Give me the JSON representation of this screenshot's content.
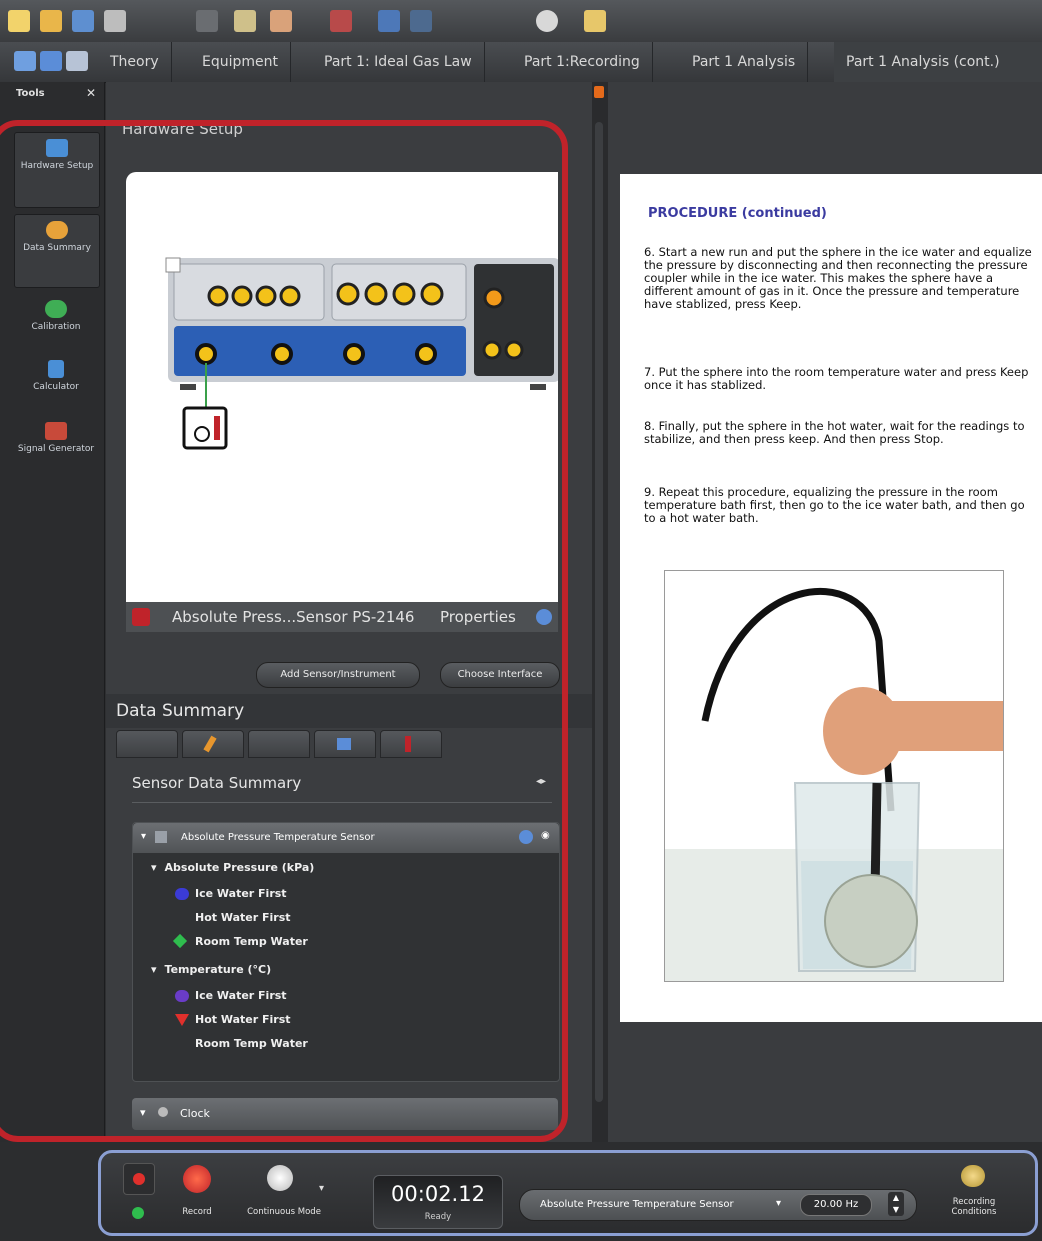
{
  "tabs": [
    "Theory",
    "Equipment",
    "Part 1: Ideal Gas Law",
    "Part 1:Recording",
    "Part 1 Analysis",
    "Part 1 Analysis (cont.)"
  ],
  "tools": {
    "header": "Tools",
    "close": "✕",
    "items": [
      {
        "label": "Hardware Setup",
        "icon": "hardware-icon",
        "color": "#4a8fd6"
      },
      {
        "label": "Data Summary",
        "icon": "data-summary-icon",
        "color": "#e7a23a"
      },
      {
        "label": "Calibration",
        "icon": "calibration-icon",
        "color": "#3fae55"
      },
      {
        "label": "Calculator",
        "icon": "calculator-icon",
        "color": "#4a8fd6"
      },
      {
        "label": "Signal Generator",
        "icon": "signal-generator-icon",
        "color": "#c84a3a"
      }
    ]
  },
  "hardware": {
    "title": "Hardware Setup",
    "sensor_label": "Absolute Press...Sensor PS-2146",
    "properties": "Properties",
    "add_sensor": "Add Sensor/Instrument",
    "choose_interface": "Choose Interface"
  },
  "data_summary": {
    "title": "Data Summary",
    "subtitle": "Sensor Data Summary",
    "sensor_name": "Absolute Pressure Temperature Sensor",
    "measurements": [
      {
        "name": "Absolute Pressure (kPa)",
        "runs": [
          {
            "label": "Ice Water First",
            "color": "#3b3bd6"
          },
          {
            "label": "Hot Water First",
            "color": "#e0302c"
          },
          {
            "label": "Room Temp Water",
            "color": "#2fbd4e"
          }
        ]
      },
      {
        "name": "Temperature (°C)",
        "runs": [
          {
            "label": "Ice Water First",
            "color": "#6a3cc8"
          },
          {
            "label": "Hot Water First",
            "color": "#e0302c"
          },
          {
            "label": "Room Temp Water",
            "color": "#2fbd4e"
          }
        ]
      }
    ],
    "clock": "Clock"
  },
  "document": {
    "heading": "PROCEDURE (continued)",
    "steps": [
      "6. Start a new run and put the sphere in the ice water and equalize the pressure by disconnecting and then reconnecting the pressure coupler while in the ice water. This makes the sphere have a different amount of gas in it. Once the pressure and temperature have stablized, press Keep.",
      "7. Put the sphere into the room temperature water and press Keep once it has stablized.",
      "8. Finally, put the sphere in the hot water, wait for the readings to stabilize, and then press keep. And then press Stop.",
      "9. Repeat this procedure, equalizing the pressure in the room temperature bath first, then go to the ice water bath, and then go to a hot water bath."
    ]
  },
  "controls": {
    "record": "Record",
    "mode": "Continuous Mode",
    "timer": "00:02.12",
    "status": "Ready",
    "sensor_select": "Absolute Pressure Temperature Sensor",
    "rate": "20.00 Hz",
    "recording_conditions": "Recording Conditions"
  }
}
